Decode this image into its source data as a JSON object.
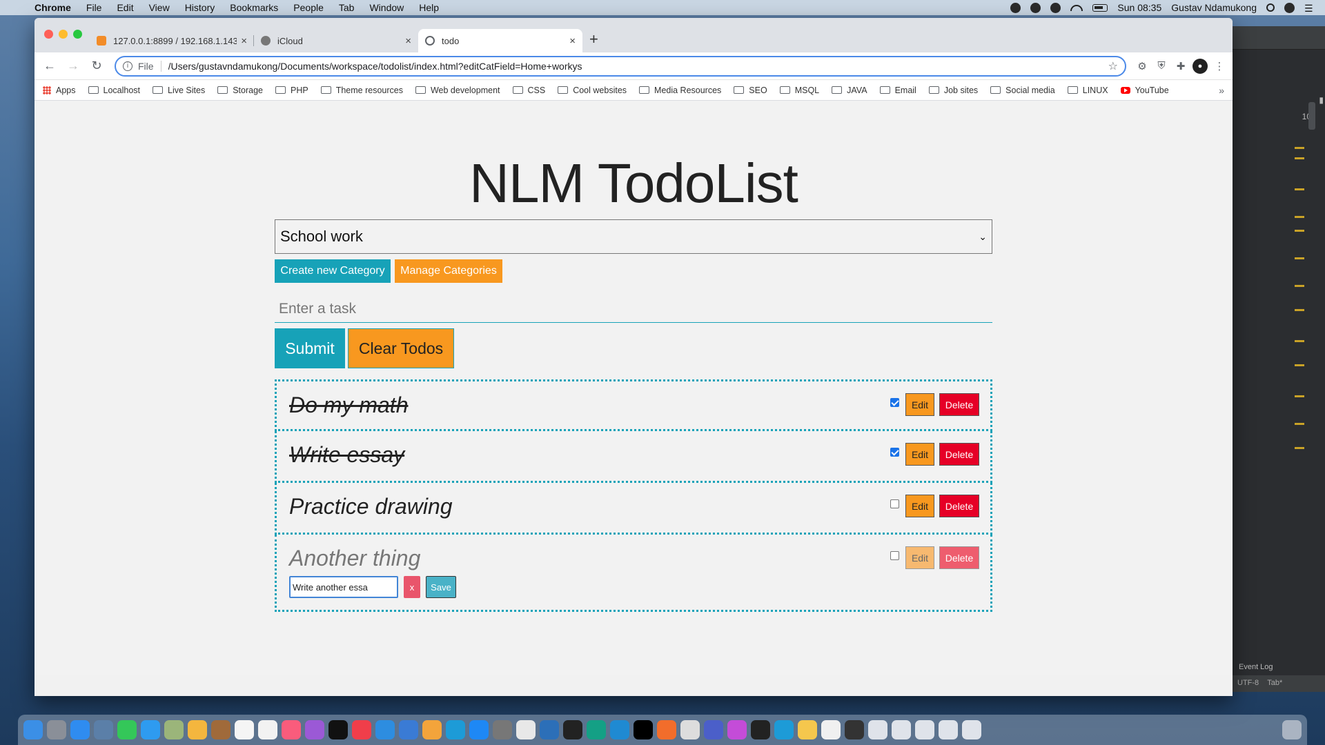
{
  "menubar": {
    "app_name": "Chrome",
    "items": [
      "File",
      "Edit",
      "View",
      "History",
      "Bookmarks",
      "People",
      "Tab",
      "Window",
      "Help"
    ],
    "clock": "Sun 08:35",
    "user": "Gustav Ndamukong"
  },
  "browser": {
    "tabs": [
      {
        "title": "127.0.0.1:8899 / 192.168.1.143",
        "favicon_color": "#f28c28"
      },
      {
        "title": "iCloud",
        "favicon_color": "#777777"
      },
      {
        "title": "todo",
        "favicon_color": "#5f6368"
      }
    ],
    "omnibox": {
      "scheme": "File",
      "url": "/Users/gustavndamukong/Documents/workspace/todolist/index.html?editCatField=Home+workys"
    },
    "bookmarks": [
      {
        "label": "Apps",
        "icon": "apps-grid-icon"
      },
      {
        "label": "Localhost",
        "icon": "folder-icon"
      },
      {
        "label": "Live Sites",
        "icon": "folder-icon"
      },
      {
        "label": "Storage",
        "icon": "folder-icon"
      },
      {
        "label": "PHP",
        "icon": "folder-icon"
      },
      {
        "label": "Theme resources",
        "icon": "folder-icon"
      },
      {
        "label": "Web development",
        "icon": "folder-icon"
      },
      {
        "label": "CSS",
        "icon": "folder-icon"
      },
      {
        "label": "Cool websites",
        "icon": "folder-icon"
      },
      {
        "label": "Media Resources",
        "icon": "folder-icon"
      },
      {
        "label": "SEO",
        "icon": "folder-icon"
      },
      {
        "label": "MSQL",
        "icon": "folder-icon"
      },
      {
        "label": "JAVA",
        "icon": "folder-icon"
      },
      {
        "label": "Email",
        "icon": "folder-icon"
      },
      {
        "label": "Job sites",
        "icon": "folder-icon"
      },
      {
        "label": "Social media",
        "icon": "folder-icon"
      },
      {
        "label": "LINUX",
        "icon": "folder-icon"
      },
      {
        "label": "YouTube",
        "icon": "youtube-icon"
      }
    ],
    "more": "»"
  },
  "app": {
    "title": "NLM TodoList",
    "category_selected": "School work",
    "create_category_label": "Create new Category",
    "manage_categories_label": "Manage Categories",
    "task_placeholder": "Enter a task",
    "submit_label": "Submit",
    "clear_label": "Clear Todos",
    "todos": [
      {
        "text": "Do my math",
        "done": true
      },
      {
        "text": "Write essay",
        "done": true
      },
      {
        "text": "Practice drawing",
        "done": false
      },
      {
        "text": "Another thing",
        "done": false
      }
    ],
    "edit_label": "Edit",
    "delete_label": "Delete",
    "editing": {
      "value": "Write another essa",
      "cancel_label": "x",
      "save_label": "Save"
    }
  },
  "ide": {
    "event_log": "Event Log",
    "encoding": "UTF-8",
    "indent": "Tab*",
    "counter": "10"
  },
  "colors": {
    "accent_teal": "#17a2b8",
    "accent_orange": "#f8981f",
    "danger_red": "#e60026"
  }
}
